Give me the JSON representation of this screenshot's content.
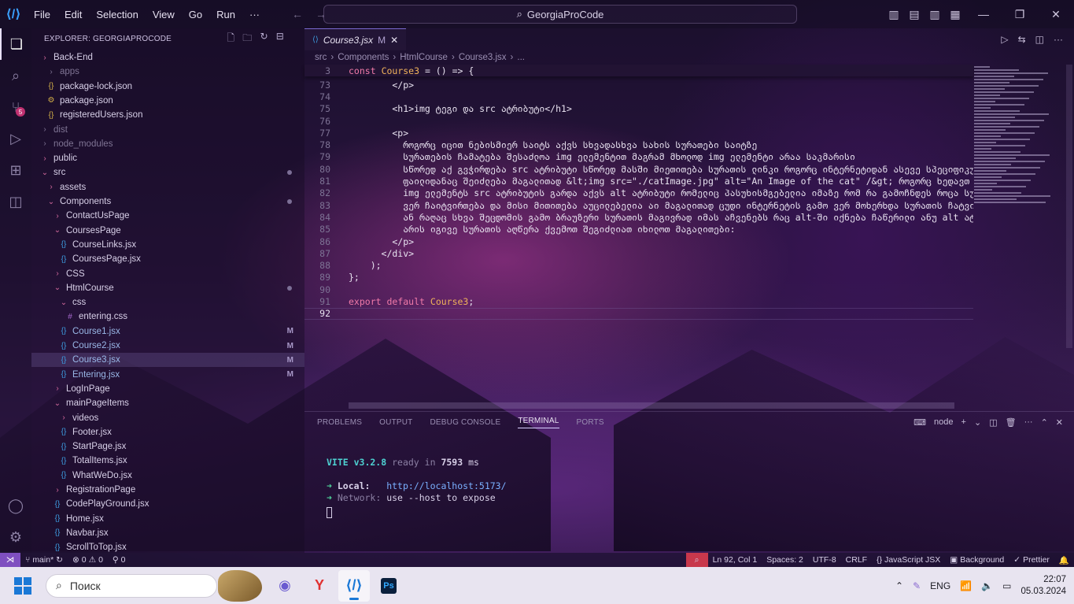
{
  "window": {
    "menu": [
      "File",
      "Edit",
      "Selection",
      "View",
      "Go",
      "Run",
      "···"
    ],
    "search": "GeorgiaProCode"
  },
  "explorer": {
    "title": "EXPLORER: GEORGIAPROCODE",
    "items": [
      {
        "label": "Back-End",
        "depth": 0,
        "type": "folder",
        "chev": "›"
      },
      {
        "label": "apps",
        "depth": 1,
        "type": "folder-dim",
        "chev": "›"
      },
      {
        "label": "package-lock.json",
        "depth": 1,
        "type": "json",
        "icon": "{}"
      },
      {
        "label": "package.json",
        "depth": 1,
        "type": "json",
        "icon": "⚙"
      },
      {
        "label": "registeredUsers.json",
        "depth": 1,
        "type": "json",
        "icon": "{}"
      },
      {
        "label": "dist",
        "depth": 0,
        "type": "folder-dim",
        "chev": "›"
      },
      {
        "label": "node_modules",
        "depth": 0,
        "type": "folder-dim",
        "chev": "›"
      },
      {
        "label": "public",
        "depth": 0,
        "type": "folder",
        "chev": "›"
      },
      {
        "label": "src",
        "depth": 0,
        "type": "folder",
        "chev": "⌄",
        "dot": true
      },
      {
        "label": "assets",
        "depth": 1,
        "type": "folder",
        "chev": "›"
      },
      {
        "label": "Components",
        "depth": 1,
        "type": "folder",
        "chev": "⌄",
        "dot": true
      },
      {
        "label": "ContactUsPage",
        "depth": 2,
        "type": "folder",
        "chev": "›"
      },
      {
        "label": "CoursesPage",
        "depth": 2,
        "type": "folder",
        "chev": "⌄"
      },
      {
        "label": "CourseLinks.jsx",
        "depth": 3,
        "type": "jsx",
        "icon": "{}"
      },
      {
        "label": "CoursesPage.jsx",
        "depth": 3,
        "type": "jsx",
        "icon": "{}"
      },
      {
        "label": "CSS",
        "depth": 2,
        "type": "folder",
        "chev": "›"
      },
      {
        "label": "HtmlCourse",
        "depth": 2,
        "type": "folder",
        "chev": "⌄",
        "dot": true
      },
      {
        "label": "css",
        "depth": 3,
        "type": "folder",
        "chev": "⌄"
      },
      {
        "label": "entering.css",
        "depth": 4,
        "type": "css",
        "icon": "#"
      },
      {
        "label": "Course1.jsx",
        "depth": 3,
        "type": "jsx-mod",
        "icon": "{}",
        "mod": "M"
      },
      {
        "label": "Course2.jsx",
        "depth": 3,
        "type": "jsx-mod",
        "icon": "{}",
        "mod": "M"
      },
      {
        "label": "Course3.jsx",
        "depth": 3,
        "type": "jsx-mod",
        "icon": "{}",
        "mod": "M",
        "selected": true
      },
      {
        "label": "Entering.jsx",
        "depth": 3,
        "type": "jsx-mod",
        "icon": "{}",
        "mod": "M"
      },
      {
        "label": "LogInPage",
        "depth": 2,
        "type": "folder",
        "chev": "›"
      },
      {
        "label": "mainPageItems",
        "depth": 2,
        "type": "folder",
        "chev": "⌄"
      },
      {
        "label": "videos",
        "depth": 3,
        "type": "folder",
        "chev": "›"
      },
      {
        "label": "Footer.jsx",
        "depth": 3,
        "type": "jsx",
        "icon": "{}"
      },
      {
        "label": "StartPage.jsx",
        "depth": 3,
        "type": "jsx",
        "icon": "{}"
      },
      {
        "label": "TotalItems.jsx",
        "depth": 3,
        "type": "jsx",
        "icon": "{}"
      },
      {
        "label": "WhatWeDo.jsx",
        "depth": 3,
        "type": "jsx",
        "icon": "{}"
      },
      {
        "label": "RegistrationPage",
        "depth": 2,
        "type": "folder",
        "chev": "›"
      },
      {
        "label": "CodePlayGround.jsx",
        "depth": 2,
        "type": "jsx",
        "icon": "{}"
      },
      {
        "label": "Home.jsx",
        "depth": 2,
        "type": "jsx",
        "icon": "{}"
      },
      {
        "label": "Navbar.jsx",
        "depth": 2,
        "type": "jsx",
        "icon": "{}"
      },
      {
        "label": "ScrollToTop.jsx",
        "depth": 2,
        "type": "jsx",
        "icon": "{}"
      }
    ]
  },
  "editor": {
    "tab": {
      "name": "Course3.jsx",
      "mod": "M"
    },
    "breadcrumb": [
      "src",
      "Components",
      "HtmlCourse",
      "Course3.jsx",
      "..."
    ],
    "sticky_line": {
      "num": "3",
      "text": "const Course3 = () => {"
    },
    "lines": [
      {
        "num": "73",
        "text": "        </p>"
      },
      {
        "num": "74",
        "text": ""
      },
      {
        "num": "75",
        "text": "        <h1>img ტეგი და src ატრიბუტი</h1>"
      },
      {
        "num": "76",
        "text": ""
      },
      {
        "num": "77",
        "text": "        <p>"
      },
      {
        "num": "78",
        "text": "          როგორც იცით ნებისმიერ საიტს აქვს სხვადასხვა სახის სურათები საიტზე"
      },
      {
        "num": "79",
        "text": "          სურათების ჩამატება შესაძლოა img ელემენტით მაგრამ მხოლოდ img ელემენტი არაა საკმარისი"
      },
      {
        "num": "80",
        "text": "          სწორედ აქ გვჭირდება src ატრიბუტი სწორედ მასში მიეთითება სურათის ლინკი როგორც ინტერნეტიდან ასევე სპეციფიკური"
      },
      {
        "num": "81",
        "text": "          ფაილიდანაც შეიძლება მაგალითად &lt;img src=\"./catImage.jpg\" alt=\"An Image of the cat\" /&gt; როგორც ხედავთ"
      },
      {
        "num": "82",
        "text": "          img ელემენტს src ატრიბუტის გარდა აქვს alt ატრიბუტი რომელიც პასუხისმგებელია იმაზე რომ რა გამოჩნდეს როცა სურათი"
      },
      {
        "num": "83",
        "text": "          ვერ ჩაიტვირთება და მისი მითითება აუცილებელია აი მაგალითად ცუდი ინტერნეტის გამო ვერ მოხერხდა სურათის ჩატვირთვა"
      },
      {
        "num": "84",
        "text": "          ან რაღაც სხვა შეცდომის გამო ბრაუზერი სურათის მაგივრად იმას აჩვენებს რაც alt-ში იქნება ჩაწერილი ანუ alt ატრიბუტი"
      },
      {
        "num": "85",
        "text": "          არის იგივე სურათის აღწერა ქვემოთ შეგიძლიათ იხილოთ მაგალითები:"
      },
      {
        "num": "86",
        "text": "        </p>"
      },
      {
        "num": "87",
        "text": "      </div>"
      },
      {
        "num": "88",
        "text": "    );"
      },
      {
        "num": "89",
        "text": "};"
      },
      {
        "num": "90",
        "text": ""
      },
      {
        "num": "91",
        "text": "export default Course3;"
      },
      {
        "num": "92",
        "text": ""
      }
    ]
  },
  "panel": {
    "tabs": [
      "PROBLEMS",
      "OUTPUT",
      "DEBUG CONSOLE",
      "TERMINAL",
      "PORTS"
    ],
    "active_tab": "TERMINAL",
    "shell": "node",
    "terminal": {
      "vite": "VITE v3.2.8",
      "ready": "ready in",
      "ms": "7593",
      "ms_unit": "ms",
      "local_label": "Local:",
      "local_url": "http://localhost:5173/",
      "network_label": "Network:",
      "network_text": "use --host to expose"
    }
  },
  "status": {
    "branch": "main*",
    "errors": "0",
    "warnings": "0",
    "ports": "0",
    "position": "Ln 92, Col 1",
    "spaces": "Spaces: 2",
    "encoding": "UTF-8",
    "eol": "CRLF",
    "language": "JavaScript JSX",
    "background": "Background",
    "prettier": "Prettier"
  },
  "taskbar": {
    "search_placeholder": "Поиск",
    "lang": "ENG",
    "time": "22:07",
    "date": "05.03.2024"
  },
  "colors": {
    "accent": "#7a6ad0",
    "folder": "#d46a9e",
    "jsx": "#3d9ce0",
    "keyword": "#f07aa8",
    "function": "#f0b35a"
  }
}
